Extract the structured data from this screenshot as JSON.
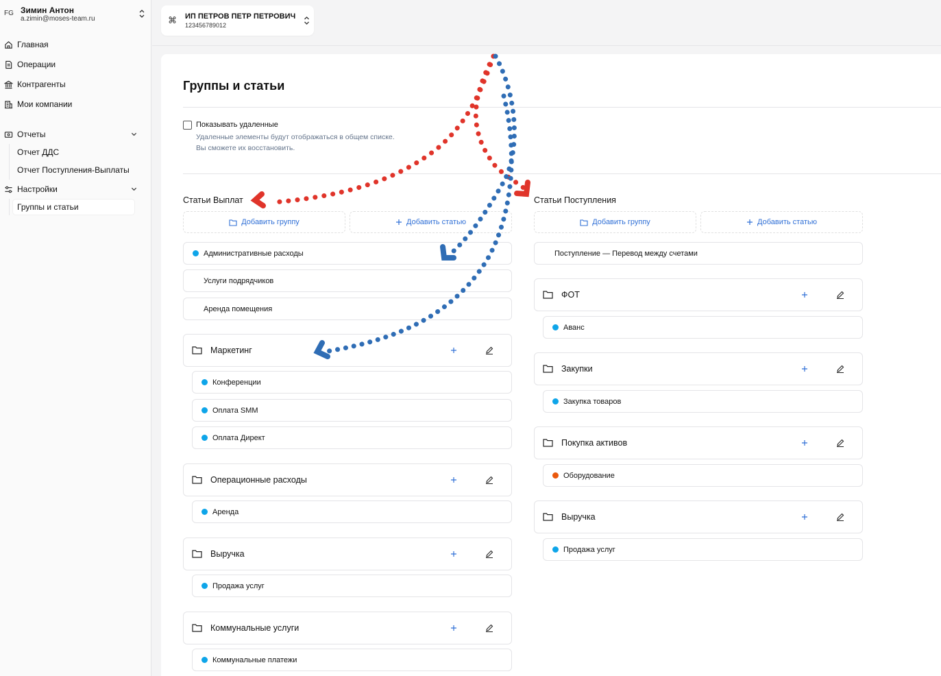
{
  "user": {
    "initials": "FG",
    "name": "Зимин Антон",
    "email": "a.zimin@moses-team.ru"
  },
  "nav": {
    "home": "Главная",
    "operations": "Операции",
    "contractors": "Контрагенты",
    "companies": "Мои компании",
    "reports": "Отчеты",
    "report_dds": "Отчет ДДС",
    "report_inout": "Отчет Поступления-Выплаты",
    "settings": "Настройки",
    "groups": "Группы и статьи"
  },
  "company": {
    "name": "ИП ПЕТРОВ ПЕТР ПЕТРОВИЧ",
    "inn": "123456789012"
  },
  "page": {
    "title": "Группы и статьи",
    "show_deleted": "Показывать удаленные",
    "hint1": "Удаленные элементы будут отображаться в общем списке.",
    "hint2": "Вы сможете их восстановить."
  },
  "payouts": {
    "title": "Статьи Выплат",
    "add_group": "Добавить группу",
    "add_item": "Добавить статью",
    "items": [
      "Административные расходы",
      "Услуги подрядчиков",
      "Аренда помещения"
    ],
    "groups": [
      {
        "name": "Маркетинг",
        "items": [
          "Конференции",
          "Оплата SMM",
          "Оплата Директ"
        ]
      },
      {
        "name": "Операционные расходы",
        "items": [
          "Аренда"
        ]
      },
      {
        "name": "Выручка",
        "items": [
          "Продажа услуг"
        ]
      },
      {
        "name": "Коммунальные услуги",
        "items": [
          "Коммунальные платежи"
        ]
      }
    ]
  },
  "incomes": {
    "title": "Статьи Поступления",
    "add_group": "Добавить группу",
    "add_item": "Добавить статью",
    "items": [
      "Поступление — Перевод между счетами"
    ],
    "groups": [
      {
        "name": "ФОТ",
        "items": [
          "Аванс"
        ]
      },
      {
        "name": "Закупки",
        "items": [
          "Закупка товаров"
        ]
      },
      {
        "name": "Покупка активов",
        "items": [
          "Оборудование"
        ]
      },
      {
        "name": "Выручка",
        "items": [
          "Продажа услуг"
        ]
      }
    ]
  },
  "colors": {
    "dot_blue": "#0ea5e9",
    "dot_orange": "#ea580c",
    "accent": "#2f6fd6",
    "arrow_red": "#e0342a",
    "arrow_blue": "#2f6db5"
  }
}
